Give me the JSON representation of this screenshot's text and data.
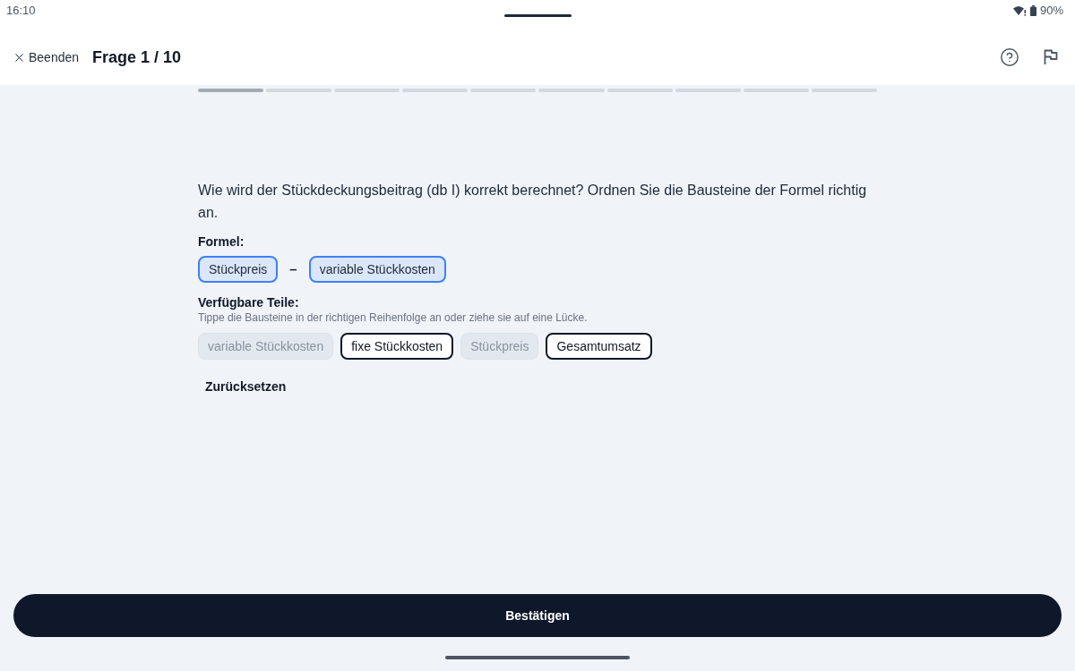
{
  "status_bar": {
    "time": "16:10",
    "battery": "90%"
  },
  "header": {
    "close_label": "Beenden",
    "title": "Frage 1 / 10"
  },
  "progress": [
    {
      "active": true
    },
    {
      "active": false
    },
    {
      "active": false
    },
    {
      "active": false
    },
    {
      "active": false
    },
    {
      "active": false
    },
    {
      "active": false
    },
    {
      "active": false
    },
    {
      "active": false
    },
    {
      "active": false
    }
  ],
  "question": "Wie wird der Stückdeckungsbeitrag (db I) korrekt berechnet? Ordnen Sie die Bausteine der Formel richtig an.",
  "formula": {
    "label": "Formel:",
    "items": [
      {
        "kind": "slot",
        "text": "Stückpreis"
      },
      {
        "kind": "operator",
        "text": "–"
      },
      {
        "kind": "slot",
        "text": "variable Stückkosten"
      }
    ]
  },
  "parts": {
    "label": "Verfügbare Teile:",
    "hint": "Tippe die Bausteine in der richtigen Reihenfolge an oder ziehe sie auf eine Lücke.",
    "pieces": [
      {
        "text": "variable Stückkosten",
        "used": true
      },
      {
        "text": "fixe Stückkosten",
        "used": false
      },
      {
        "text": "Stückpreis",
        "used": true
      },
      {
        "text": "Gesamtumsatz",
        "used": false
      }
    ]
  },
  "reset_label": "Zurücksetzen",
  "confirm_label": "Bestätigen"
}
